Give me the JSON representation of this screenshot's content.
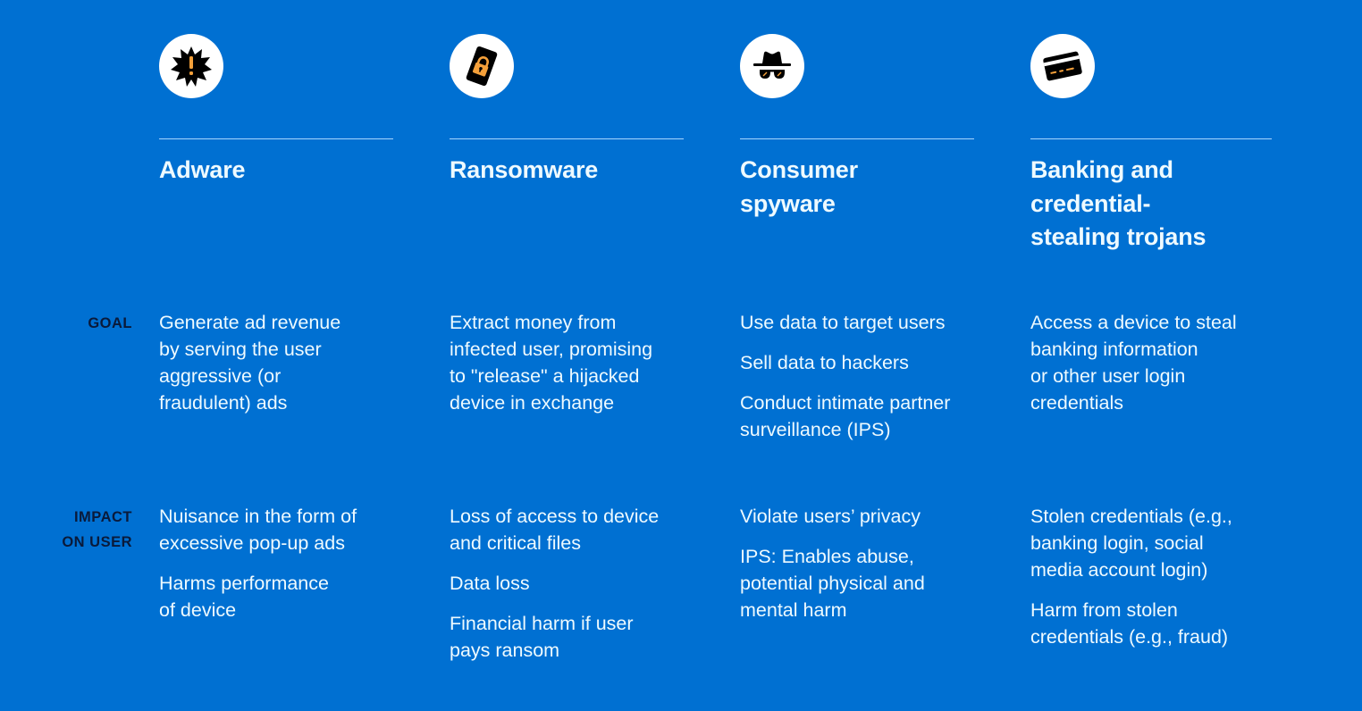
{
  "row_labels": {
    "goal": "GOAL",
    "impact": "IMPACT\nON USER"
  },
  "colors": {
    "background": "#0070d2",
    "text": "#eefaff",
    "label_text": "#0a1a3a",
    "icon_accent": "#f5a03a",
    "icon_dark": "#000000",
    "divider": "#a8d7ff"
  },
  "columns": [
    {
      "icon": "alert-burst-icon",
      "title": "Adware",
      "goal": [
        "Generate ad revenue\nby serving the user\naggressive (or\nfraudulent) ads"
      ],
      "impact": [
        "Nuisance in the form of\nexcessive pop-up ads",
        "Harms performance\nof device"
      ]
    },
    {
      "icon": "locked-phone-icon",
      "title": "Ransomware",
      "goal": [
        "Extract money from\ninfected user, promising\nto \"release\" a hijacked\ndevice in exchange"
      ],
      "impact": [
        "Loss of access to device\nand critical files",
        "Data loss",
        "Financial harm if user\npays ransom"
      ]
    },
    {
      "icon": "spy-hat-glasses-icon",
      "title": "Consumer\nspyware",
      "goal": [
        "Use data to target users",
        "Sell data to hackers",
        "Conduct intimate partner\nsurveillance (IPS)"
      ],
      "impact": [
        "Violate users’ privacy",
        "IPS: Enables abuse,\npotential physical and\nmental harm"
      ]
    },
    {
      "icon": "credit-card-icon",
      "title": "Banking and\ncredential-\nstealing trojans",
      "goal": [
        "Access a device to steal\nbanking information\nor other user login\ncredentials"
      ],
      "impact": [
        "Stolen credentials (e.g.,\nbanking login, social\nmedia account login)",
        "Harm from stolen\ncredentials (e.g., fraud)"
      ]
    }
  ]
}
